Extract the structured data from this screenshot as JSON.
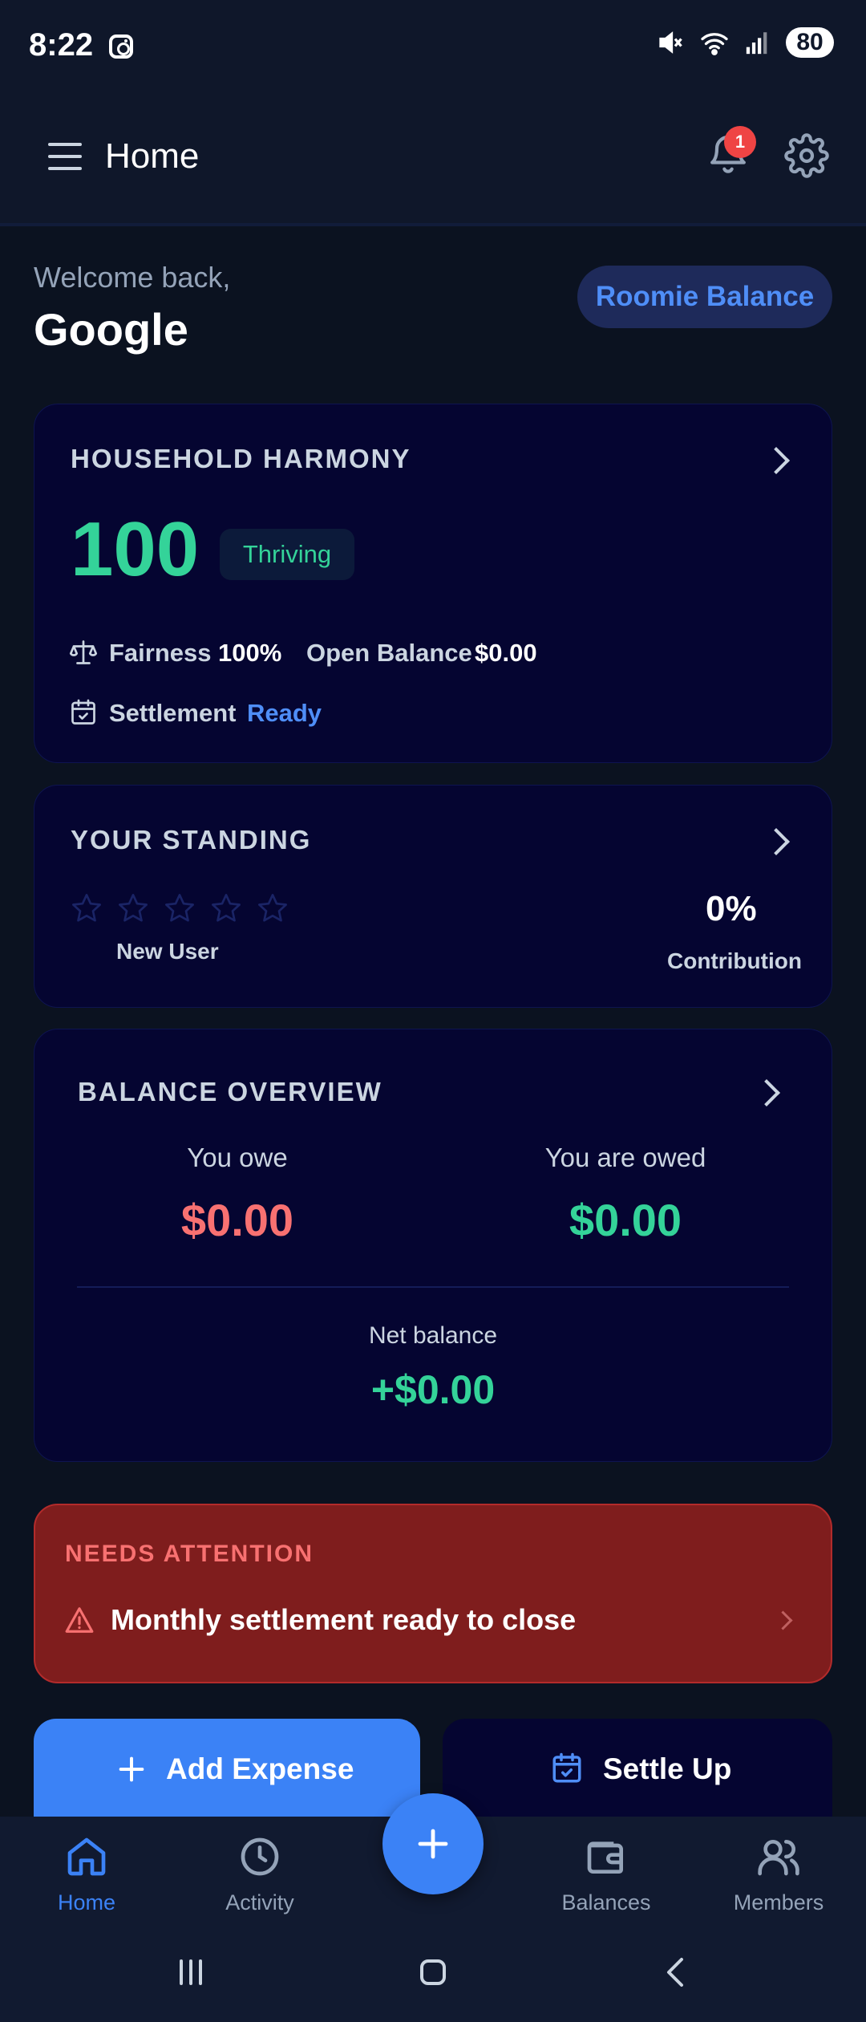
{
  "status_bar": {
    "time": "8:22",
    "battery": "80"
  },
  "app_bar": {
    "title": "Home",
    "notification_count": "1"
  },
  "greeting": {
    "welcome": "Welcome back,",
    "name": "Google",
    "pill_label": "Roomie Balance"
  },
  "harmony": {
    "heading": "HOUSEHOLD HARMONY",
    "score": "100",
    "badge": "Thriving",
    "fairness_label": "Fairness",
    "fairness_value": "100%",
    "open_balance_label": "Open Balance",
    "open_balance_value": "$0.00",
    "settlement_label": "Settlement",
    "settlement_value": "Ready"
  },
  "standing": {
    "heading": "YOUR STANDING",
    "rating": 0,
    "rating_max": 5,
    "rank_label": "New User",
    "contribution_value": "0%",
    "contribution_label": "Contribution"
  },
  "balance": {
    "heading": "BALANCE OVERVIEW",
    "owe_label": "You owe",
    "owe_value": "$0.00",
    "owed_label": "You are owed",
    "owed_value": "$0.00",
    "net_label": "Net balance",
    "net_value": "+$0.00"
  },
  "attention": {
    "heading": "NEEDS ATTENTION",
    "message": "Monthly settlement ready to close"
  },
  "actions": {
    "add_expense": "Add Expense",
    "settle_up": "Settle Up"
  },
  "bottom_nav": {
    "home": "Home",
    "activity": "Activity",
    "balances": "Balances",
    "members": "Members"
  },
  "colors": {
    "accent": "#3b82f6",
    "positive": "#34d399",
    "negative": "#f87171",
    "card_bg": "#050531",
    "alert_bg": "#7f1d1d"
  },
  "icons": [
    "instagram-icon",
    "mute-icon",
    "wifi-icon",
    "signal-icon",
    "menu-icon",
    "bell-icon",
    "gear-icon",
    "scale-icon",
    "calendar-check-icon",
    "star-icon",
    "chevron-right-icon",
    "warning-icon",
    "plus-icon",
    "home-icon",
    "clock-icon",
    "wallet-icon",
    "users-icon"
  ]
}
